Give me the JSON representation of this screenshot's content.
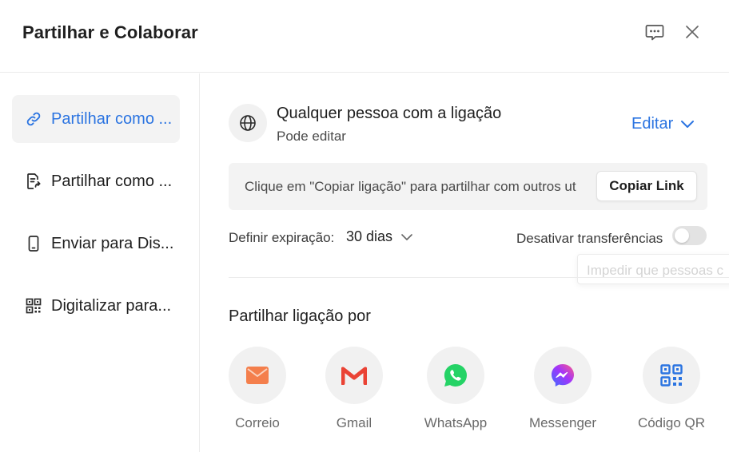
{
  "header": {
    "title": "Partilhar e Colaborar",
    "feedback_icon": "feedback-icon",
    "close_icon": "close-icon"
  },
  "sidebar": {
    "items": [
      {
        "label": "Partilhar como ...",
        "icon": "link-icon",
        "active": true
      },
      {
        "label": "Partilhar como ...",
        "icon": "file-share-icon",
        "active": false
      },
      {
        "label": "Enviar para Dis...",
        "icon": "phone-icon",
        "active": false
      },
      {
        "label": "Digitalizar para...",
        "icon": "qr-code-icon",
        "active": false
      }
    ]
  },
  "access": {
    "title": "Qualquer pessoa com a ligação",
    "subtitle": "Pode editar",
    "edit_label": "Editar"
  },
  "link": {
    "text": "Clique em \"Copiar ligação\" para partilhar com outros ut",
    "copy_label": "Copiar Link"
  },
  "expiration": {
    "label": "Definir expiração:",
    "value": "30 dias"
  },
  "downloads": {
    "label": "Desativar transferências",
    "enabled": false,
    "tooltip": "Impedir que pessoas c"
  },
  "share_via": {
    "title": "Partilhar ligação por",
    "options": [
      {
        "label": "Correio",
        "icon": "mail-icon"
      },
      {
        "label": "Gmail",
        "icon": "gmail-icon"
      },
      {
        "label": "WhatsApp",
        "icon": "whatsapp-icon"
      },
      {
        "label": "Messenger",
        "icon": "messenger-icon"
      },
      {
        "label": "Código QR",
        "icon": "qr-code-icon"
      }
    ]
  },
  "colors": {
    "accent": "#2b74e1",
    "mail": "#f47f4c",
    "gmail": "#ea4335",
    "whatsapp": "#25d366",
    "messenger": "#a334fa",
    "qr": "#2b74e1"
  }
}
